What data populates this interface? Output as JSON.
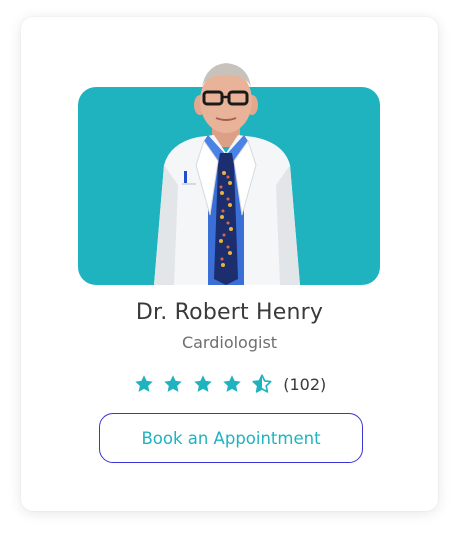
{
  "doctor": {
    "name": "Dr. Robert Henry",
    "specialty": "Cardiologist",
    "rating": 4.5,
    "rating_max": 5,
    "review_count": "(102)"
  },
  "actions": {
    "book_label": "Book an Appointment"
  },
  "colors": {
    "accent": "#1fb3c0",
    "photo_bg": "#1fb3c0",
    "button_border": "#3b34d6",
    "text_dark": "#3a3a3a",
    "text_muted": "#6e6e6e"
  },
  "icons": {
    "star": "star-icon",
    "half_star": "star-half-icon"
  }
}
